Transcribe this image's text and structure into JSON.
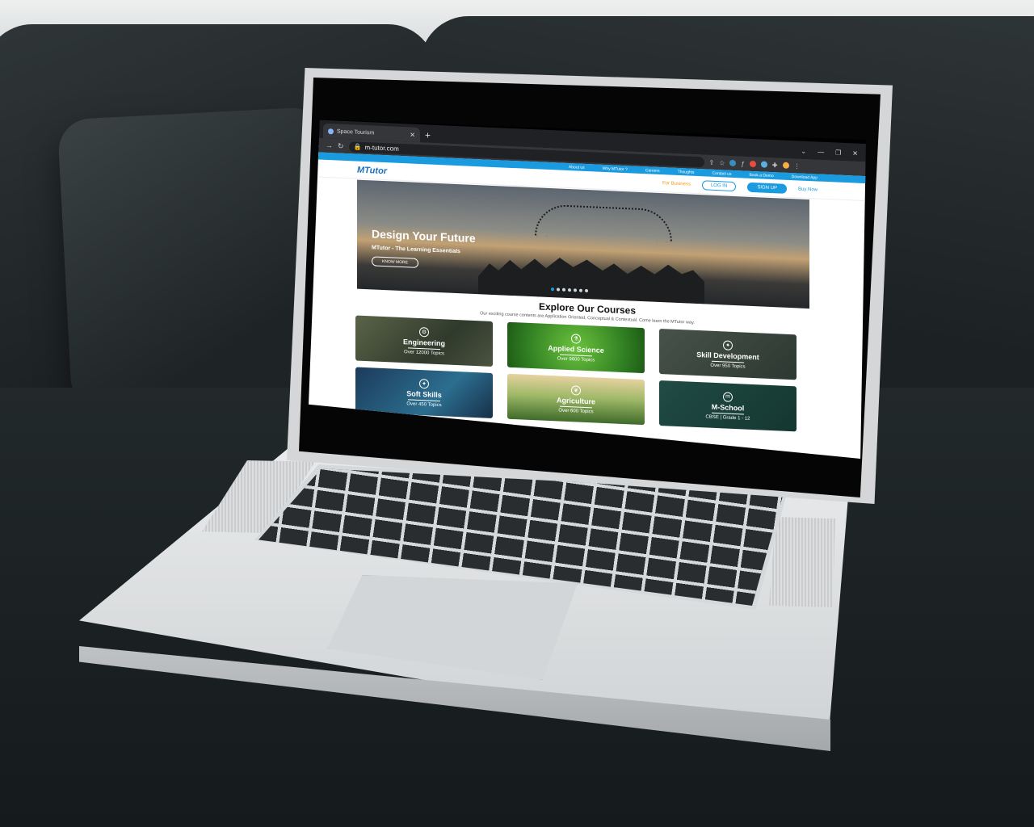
{
  "browser": {
    "tab_title": "Space Tourism",
    "url": "m-tutor.com"
  },
  "site": {
    "topnav": [
      "About us",
      "Why MTutor ?",
      "Careers",
      "Thoughts",
      "Contact us",
      "Book a Demo",
      "Download App"
    ],
    "logo": "MTutor",
    "for_business": "For Business",
    "login": "LOG IN",
    "signup": "SIGN UP",
    "buy_now": "Buy Now",
    "hero": {
      "title": "Design Your Future",
      "subtitle": "MTutor - The Learning Essentials",
      "cta": "KNOW MORE",
      "slide_count": 7,
      "active_slide": 0
    },
    "explore": {
      "title": "Explore Our Courses",
      "subtitle": "Our exciting course contents are Application Oriented, Conceptual & Contextual. Come learn the MTutor way."
    },
    "courses": [
      {
        "title": "Engineering",
        "sub": "Over 12000 Topics",
        "icon": "gear-icon"
      },
      {
        "title": "Applied Science",
        "sub": "Over 9600 Topics",
        "icon": "microscope-icon"
      },
      {
        "title": "Skill Development",
        "sub": "Over 950 Topics",
        "icon": "bulb-icon"
      },
      {
        "title": "Soft Skills",
        "sub": "Over 450 Topics",
        "icon": "bulb-icon"
      },
      {
        "title": "Agriculture",
        "sub": "Over 600 Topics",
        "icon": "leaf-icon"
      },
      {
        "title": "M-School",
        "sub": "CBSE | Grade 1 - 12",
        "icon": "m-icon"
      }
    ]
  }
}
